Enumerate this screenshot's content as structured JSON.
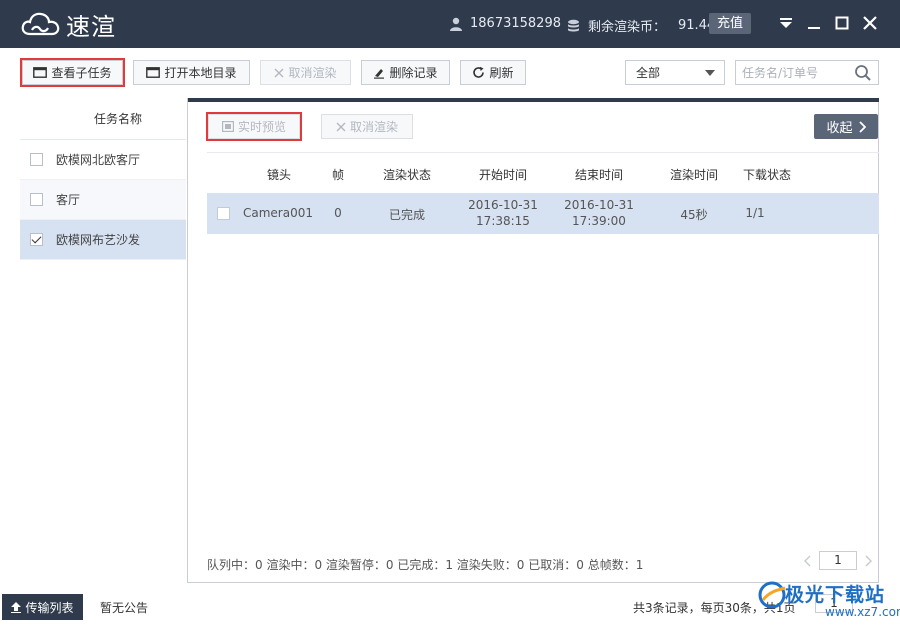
{
  "app": {
    "name": "速渲",
    "phone": "18673158298",
    "coins_label": "剩余渲染币：",
    "coins_value": "91.44",
    "recharge_label": "充值"
  },
  "toolbar": {
    "view_subtasks": "查看子任务",
    "open_local_dir": "打开本地目录",
    "cancel_render": "取消渲染",
    "delete_record": "删除记录",
    "refresh": "刷新",
    "filter_value": "全部",
    "search_placeholder": "任务名/订单号"
  },
  "task_list": {
    "header": "任务名称",
    "items": [
      {
        "name": "欧模网北欧客厅",
        "checked": false
      },
      {
        "name": "客厅",
        "checked": false
      },
      {
        "name": "欧模网布艺沙发",
        "checked": true
      }
    ]
  },
  "detail": {
    "live_preview": "实时预览",
    "cancel_render": "取消渲染",
    "collapse": "收起",
    "columns": [
      "镜头",
      "帧",
      "渲染状态",
      "开始时间",
      "结束时间",
      "渲染时间",
      "下载状态"
    ],
    "rows": [
      {
        "camera": "Camera001",
        "frame": "0",
        "status": "已完成",
        "start_date": "2016-10-31",
        "start_time": "17:38:15",
        "end_date": "2016-10-31",
        "end_time": "17:39:00",
        "render_time": "45秒",
        "download": "1/1"
      }
    ],
    "stats": "队列中：0  渲染中：0  渲染暂停：0  已完成：1  渲染失败：0  已取消：0  总帧数：1",
    "page": "1"
  },
  "statusbar": {
    "transfer_list": "传输列表",
    "notice": "暂无公告",
    "records": "共3条记录，每页30条，共1页",
    "page": "1"
  },
  "watermark": {
    "text": "极光下载站",
    "url": "www.xz7.com"
  },
  "colors": {
    "titlebar": "#2f3b4c",
    "selected_row": "#d6e1f1",
    "highlight": "#e03b3b",
    "accent_button": "#5a6678"
  }
}
